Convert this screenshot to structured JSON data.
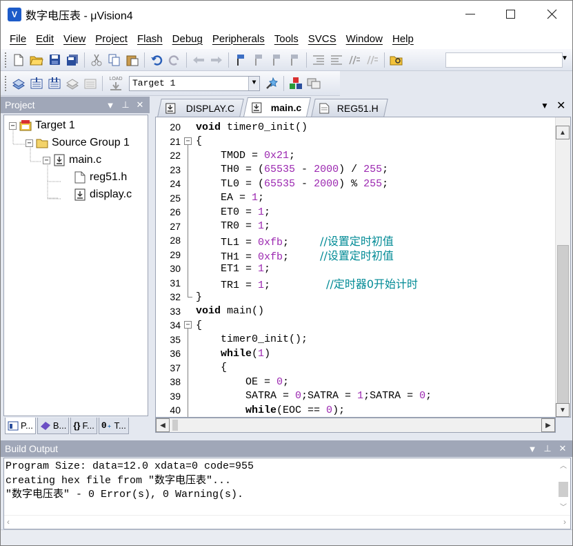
{
  "window": {
    "title": "数字电压表 - μVision4",
    "app_icon": "V",
    "controls": {
      "minimize": "—",
      "maximize": "☐",
      "close": "✕"
    }
  },
  "menu": [
    "File",
    "Edit",
    "View",
    "Project",
    "Flash",
    "Debug",
    "Peripherals",
    "Tools",
    "SVCS",
    "Window",
    "Help"
  ],
  "toolbar2": {
    "target": "Target 1",
    "load": "LOAD"
  },
  "project_panel": {
    "title": "Project",
    "tree": {
      "target": "Target 1",
      "group": "Source Group 1",
      "file_main": "main.c",
      "file_reg": "reg51.h",
      "file_display": "display.c"
    },
    "tabs": [
      "P...",
      "B...",
      "F...",
      "T..."
    ]
  },
  "editor": {
    "tabs": [
      "DISPLAY.C",
      "main.c",
      "REG51.H"
    ],
    "active_tab": "main.c",
    "lines": [
      {
        "n": "20",
        "fold": "",
        "html": "<span class=\"kw\">void</span> timer0_init()"
      },
      {
        "n": "21",
        "fold": "minus",
        "html": "{"
      },
      {
        "n": "22",
        "fold": "line",
        "html": "    TMOD = <span class=\"num\">0x21</span>;"
      },
      {
        "n": "23",
        "fold": "line",
        "html": "    TH0 = (<span class=\"num\">65535</span> - <span class=\"num\">2000</span>) / <span class=\"num\">255</span>;"
      },
      {
        "n": "24",
        "fold": "line",
        "html": "    TL0 = (<span class=\"num\">65535</span> - <span class=\"num\">2000</span>) % <span class=\"num\">255</span>;"
      },
      {
        "n": "25",
        "fold": "line",
        "html": "    EA = <span class=\"num\">1</span>;"
      },
      {
        "n": "26",
        "fold": "line",
        "html": "    ET0 = <span class=\"num\">1</span>;"
      },
      {
        "n": "27",
        "fold": "line",
        "html": "    TR0 = <span class=\"num\">1</span>;"
      },
      {
        "n": "28",
        "fold": "line",
        "html": "    TL1 = <span class=\"num\">0xfb</span>;     <span class=\"cmt\">//设置定时初值</span>"
      },
      {
        "n": "29",
        "fold": "line",
        "html": "    TH1 = <span class=\"num\">0xfb</span>;     <span class=\"cmt\">//设置定时初值</span>"
      },
      {
        "n": "30",
        "fold": "line",
        "html": "    ET1 = <span class=\"num\">1</span>;"
      },
      {
        "n": "31",
        "fold": "line",
        "html": "    TR1 = <span class=\"num\">1</span>;         <span class=\"cmt\">//定时器0开始计时</span>"
      },
      {
        "n": "32",
        "fold": "end",
        "html": "}"
      },
      {
        "n": "33",
        "fold": "",
        "html": "<span class=\"kw\">void</span> main()"
      },
      {
        "n": "34",
        "fold": "minus",
        "html": "{"
      },
      {
        "n": "35",
        "fold": "line",
        "html": "    timer0_init();"
      },
      {
        "n": "36",
        "fold": "line",
        "html": "    <span class=\"kw\">while</span>(<span class=\"num\">1</span>)"
      },
      {
        "n": "37",
        "fold": "line",
        "html": "    {"
      },
      {
        "n": "38",
        "fold": "line",
        "html": "        OE = <span class=\"num\">0</span>;"
      },
      {
        "n": "39",
        "fold": "line",
        "html": "        SATRA = <span class=\"num\">0</span>;SATRA = <span class=\"num\">1</span>;SATRA = <span class=\"num\">0</span>;"
      },
      {
        "n": "40",
        "fold": "line",
        "html": "        <span class=\"kw\">while</span>(EOC == <span class=\"num\">0</span>);"
      }
    ]
  },
  "build_output": {
    "title": "Build Output",
    "lines": [
      "Program Size: data=12.0 xdata=0 code=955",
      "creating hex file from \"数字电压表\"...",
      "\"数字电压表\" - 0 Error(s), 0 Warning(s)."
    ]
  },
  "colors": {
    "keyword": "#000000",
    "number": "#9b27b0",
    "comment": "#008a95",
    "panel_title": "#a0a7b8"
  }
}
